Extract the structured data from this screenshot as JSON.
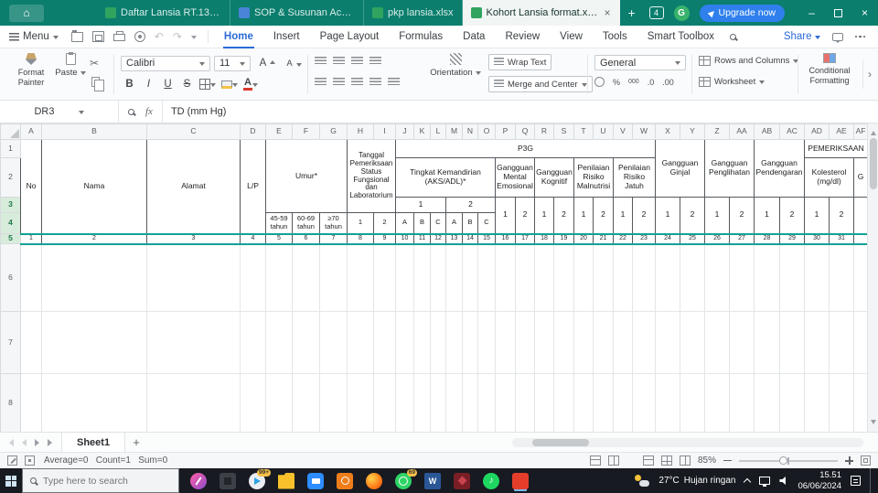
{
  "glyphs": {
    "home": "⌂",
    "min": "–",
    "close": "×",
    "scissors": "✂",
    "undo": "↶",
    "redo": "↷",
    "music": "♪",
    "more_chevron": "›"
  },
  "titlebar": {
    "doc_tabs": [
      {
        "label": "Daftar Lansia RT.13 Th 2023 Ha...",
        "icon": "sheet"
      },
      {
        "label": "SOP & Susunan Acara.docx",
        "icon": "doc"
      },
      {
        "label": "pkp lansia.xlsx",
        "icon": "sheet"
      },
      {
        "label": "Kohort Lansia format.xl...",
        "icon": "sheet"
      }
    ],
    "new_tab": "+",
    "badge_count": "4",
    "avatar_letter": "G",
    "upgrade_label": "Upgrade now"
  },
  "menubar": {
    "menu_label": "Menu",
    "tabs": [
      "Home",
      "Insert",
      "Page Layout",
      "Formulas",
      "Data",
      "Review",
      "View",
      "Tools",
      "Smart Toolbox"
    ],
    "share_label": "Share"
  },
  "ribbon": {
    "format_painter_line1": "Format",
    "format_painter_line2": "Painter",
    "paste_label": "Paste",
    "font_name": "Calibri",
    "font_size": "11",
    "bold": "B",
    "italic": "I",
    "underline": "U",
    "strike": "S",
    "grow": "A",
    "shrink": "A",
    "font_color": "A",
    "orientation_label": "Orientation",
    "wrap_text_label": "Wrap Text",
    "merge_center_label": "Merge and Center",
    "number_format": "General",
    "percent": "%",
    "thousand": "000",
    "dec_inc": ".0",
    "dec_dec": ".00",
    "rows_columns_label": "Rows and Columns",
    "worksheet_label": "Worksheet",
    "conditional_line1": "Conditional",
    "conditional_line2": "Formatting"
  },
  "formula_bar": {
    "name_box": "DR3",
    "fx_label": "fx",
    "content": "TD (mm Hg)"
  },
  "grid": {
    "columns": [
      "A",
      "B",
      "C",
      "D",
      "E",
      "F",
      "G",
      "H",
      "I",
      "J",
      "K",
      "L",
      "M",
      "N",
      "O",
      "P",
      "Q",
      "R",
      "S",
      "T",
      "U",
      "V",
      "W",
      "X",
      "Y",
      "Z",
      "AA",
      "AB",
      "AC",
      "AD",
      "AE",
      "AF"
    ],
    "row_numbers": [
      "1",
      "2",
      "3",
      "4",
      "5",
      "6",
      "7",
      "8"
    ],
    "numbering": [
      "1",
      "2",
      "3",
      "4",
      "5",
      "6",
      "7",
      "8",
      "9",
      "10",
      "11",
      "12",
      "13",
      "14",
      "15",
      "16",
      "17",
      "18",
      "19",
      "20",
      "21",
      "22",
      "23",
      "24",
      "25",
      "26",
      "27",
      "28",
      "29",
      "30",
      "31"
    ],
    "header": {
      "no": "No",
      "nama": "Nama",
      "alamat": "Alamat",
      "lp": "L/P",
      "umur": "Umur*",
      "umur1": "45-59 tahun",
      "umur2": "60-69 tahun",
      "umur3": "≥70 tahun",
      "tanggal": "Tanggal Pemeriksaan Status Fungsional dan Laboratorium",
      "p3g": "P3G",
      "aks": "Tingkat Kemandirian (AKS/ADL)*",
      "one": "1",
      "two": "2",
      "a": "A",
      "b": "B",
      "c": "C",
      "mental": "Gangguan Mental Emosional",
      "kognitif": "Gangguan Kognitif",
      "malnutrisi": "Penilaian Risiko Malnutrisi",
      "jatuh": "Penilaian Risiko Jatuh",
      "ginjal": "Gangguan Ginjal",
      "penglihatan": "Gangguan Penglihatan",
      "pendengaran": "Gangguan Pendengaran",
      "pemeriksaan": "PEMERIKSAAN",
      "kolesterol": "Kolesterol (mg/dl)",
      "gula_partial": "G"
    }
  },
  "sheetbar": {
    "sheet_name": "Sheet1",
    "add_sheet": "+"
  },
  "statusbar": {
    "summary": "Average=0   Count=1   Sum=0",
    "zoom_percent": "85%"
  },
  "taskbar": {
    "search_placeholder": "Type here to search",
    "word_letter": "W",
    "badge_99": "99+",
    "badge_69": "69",
    "weather_temp": "27°C",
    "weather_desc": "Hujan ringan",
    "time": "15.51",
    "date": "06/06/2024"
  }
}
